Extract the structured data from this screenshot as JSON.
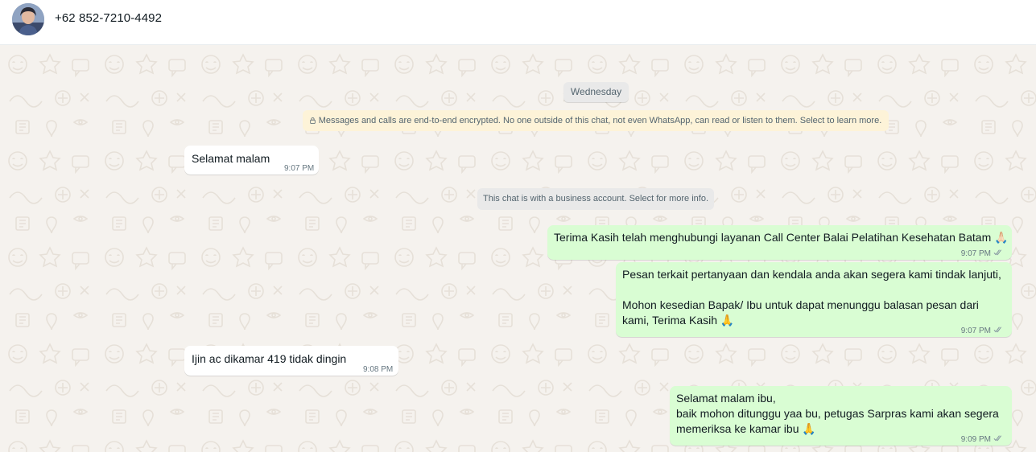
{
  "header": {
    "contact": "+62 852-7210-4492"
  },
  "chat": {
    "day_label": "Wednesday",
    "encryption_notice": "Messages and calls are end-to-end encrypted. No one outside of this chat, not even WhatsApp, can read or listen to them. Select to learn more.",
    "business_notice": "This chat is with a business account. Select for more info.",
    "messages": [
      {
        "direction": "in",
        "text": "Selamat malam",
        "time": "9:07 PM"
      },
      {
        "direction": "out",
        "text": "Terima Kasih telah menghubungi layanan Call Center Balai Pelatihan Kesehatan Batam 🙏🏻",
        "time": "9:07 PM"
      },
      {
        "direction": "out",
        "text": "Pesan terkait pertanyaan dan kendala anda akan segera kami tindak lanjuti,\n\nMohon kesedian Bapak/ Ibu untuk dapat menunggu balasan pesan dari\nkami, Terima Kasih 🙏",
        "time": "9:07 PM"
      },
      {
        "direction": "in",
        "text": "Ijin ac dikamar 419 tidak dingin",
        "time": "9:08 PM"
      },
      {
        "direction": "out",
        "text": "Selamat malam ibu,\nbaik mohon ditunggu yaa bu, petugas Sarpras kami akan segera\nmemeriksa ke kamar ibu 🙏",
        "time": "9:09 PM"
      }
    ]
  },
  "colors": {
    "outgoing_bubble": "#d9fdd3",
    "incoming_bubble": "#ffffff",
    "encryption_bg": "#fdf3d8",
    "read_ticks": "#8696a0"
  }
}
